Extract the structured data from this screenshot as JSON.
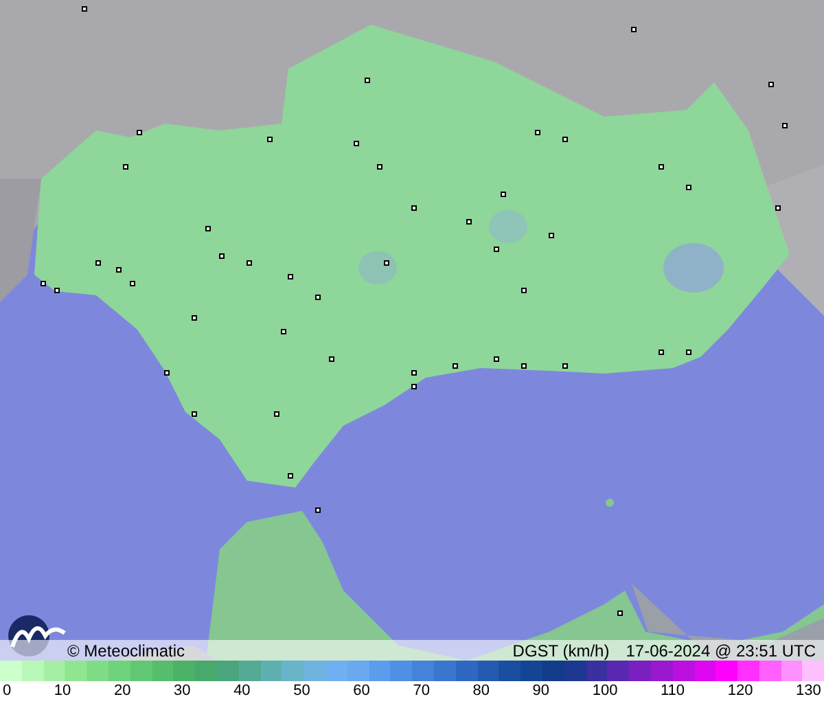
{
  "caption": {
    "credit": "© Meteoclimatic",
    "variable": "DGST (km/h)",
    "timestamp": "17-06-2024 @ 23:51 UTC"
  },
  "legend": {
    "ticks": [
      "0",
      "10",
      "20",
      "30",
      "40",
      "50",
      "60",
      "70",
      "80",
      "90",
      "100",
      "110",
      "120",
      "130"
    ]
  }
}
